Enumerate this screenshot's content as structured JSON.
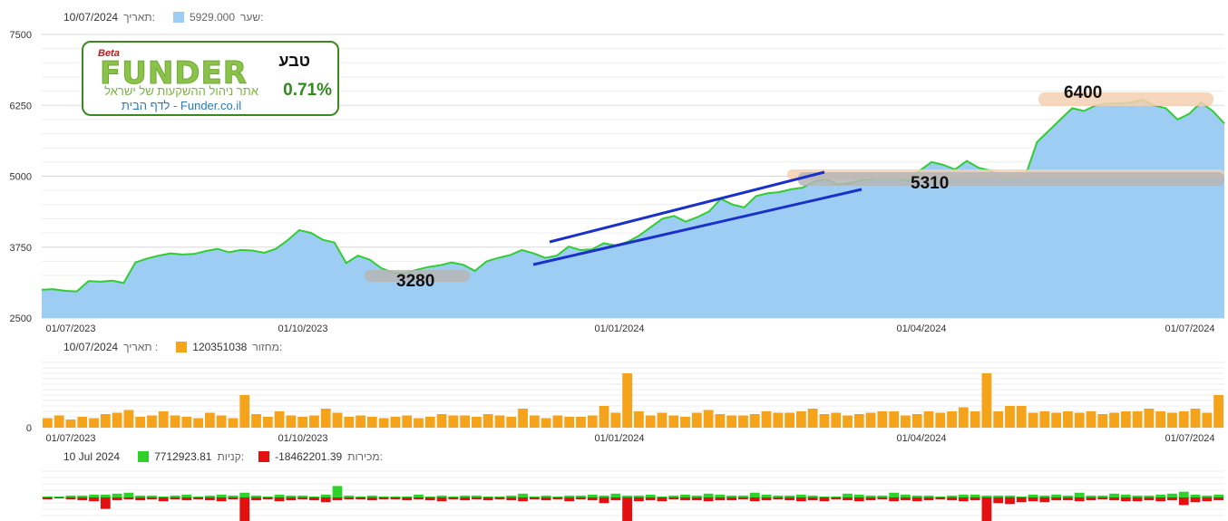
{
  "price_legend": {
    "date_label": "תאריך:",
    "date_value": "10/07/2024",
    "rate_label": "שער:",
    "rate_value": "5929.000",
    "color": "#9ecdf3"
  },
  "volume_legend": {
    "date_label": "תאריך :",
    "date_value": "10/07/2024",
    "turnover_label": "מחזור:",
    "turnover_value": "120351038",
    "color": "#f5a31a"
  },
  "flow_legend": {
    "date_value": "10 Jul 2024",
    "buys_label": "קניות:",
    "buys_value": "7712923.81",
    "buys_color": "#2fd12b",
    "sells_label": "מכירות:",
    "sells_value": "-18462201.39",
    "sells_color": "#e21010"
  },
  "logo": {
    "beta": "Beta",
    "wordmark": "FUNDER",
    "tagline": "אתר ניהול ההשקעות של ישראל",
    "link_text": "לדף הבית - Funder.co.il",
    "instrument": "טבע",
    "change": "0.71%"
  },
  "annotations": {
    "level_low": "3280",
    "level_mid": "5310",
    "level_high": "6400"
  },
  "chart_data": [
    {
      "type": "area",
      "y_ticks": [
        "7500",
        "6250",
        "5000",
        "3750",
        "2500"
      ],
      "ylim": [
        2500,
        7500
      ],
      "x_tick_labels": [
        "01/07/2023",
        "01/10/2023",
        "01/01/2024",
        "01/04/2024",
        "01/07/2024"
      ],
      "series": [
        {
          "name": "שער",
          "color": "#9ecdf3",
          "line_color": "#32cd32",
          "values": [
            3000,
            3010,
            2980,
            2970,
            3150,
            3140,
            3160,
            3120,
            3480,
            3550,
            3600,
            3640,
            3620,
            3630,
            3680,
            3720,
            3660,
            3700,
            3690,
            3650,
            3720,
            3870,
            4050,
            4000,
            3880,
            3830,
            3470,
            3600,
            3530,
            3380,
            3300,
            3290,
            3350,
            3400,
            3430,
            3480,
            3440,
            3330,
            3500,
            3560,
            3610,
            3700,
            3640,
            3560,
            3600,
            3760,
            3700,
            3710,
            3820,
            3780,
            3840,
            3950,
            4100,
            4250,
            4300,
            4200,
            4280,
            4380,
            4600,
            4500,
            4450,
            4650,
            4700,
            4720,
            4770,
            4800,
            4910,
            4950,
            4850,
            4880,
            4930,
            4950,
            4980,
            4960,
            4920,
            5100,
            5250,
            5200,
            5120,
            5270,
            5150,
            5100,
            5000,
            4950,
            5000,
            5600,
            5800,
            6000,
            6200,
            6150,
            6250,
            6280,
            6280,
            6300,
            6350,
            6250,
            6200,
            6000,
            6100,
            6300,
            6150,
            5929
          ]
        }
      ]
    },
    {
      "type": "bar",
      "y_ticks": [
        "0"
      ],
      "x_tick_labels": [
        "01/07/2023",
        "01/10/2023",
        "01/01/2024",
        "01/04/2024",
        "01/07/2024"
      ],
      "series": [
        {
          "name": "מחזור",
          "color": "#f5a31a",
          "values": [
            35,
            45,
            30,
            40,
            35,
            50,
            55,
            65,
            40,
            45,
            60,
            45,
            40,
            35,
            55,
            45,
            35,
            120,
            50,
            40,
            60,
            45,
            40,
            45,
            70,
            55,
            40,
            45,
            40,
            35,
            40,
            45,
            35,
            40,
            50,
            45,
            45,
            40,
            50,
            45,
            40,
            70,
            45,
            35,
            45,
            40,
            40,
            45,
            80,
            55,
            200,
            60,
            45,
            55,
            45,
            40,
            55,
            65,
            50,
            45,
            45,
            50,
            60,
            55,
            55,
            60,
            70,
            50,
            55,
            45,
            50,
            55,
            60,
            60,
            45,
            50,
            60,
            55,
            60,
            75,
            60,
            200,
            60,
            80,
            80,
            55,
            60,
            55,
            60,
            55,
            60,
            50,
            55,
            60,
            60,
            70,
            60,
            55,
            60,
            70,
            55,
            120
          ]
        }
      ]
    },
    {
      "type": "bar",
      "x_tick_labels": [
        "01/07/2023",
        "01/10/2023",
        "01/01/2024",
        "01/04/2024",
        "01/07/2024"
      ],
      "series": [
        {
          "name": "קניות",
          "color": "#2fd12b",
          "values": [
            1,
            1,
            2,
            2,
            3,
            3,
            4,
            5,
            2,
            2,
            1,
            2,
            3,
            1,
            2,
            3,
            2,
            5,
            2,
            1,
            3,
            2,
            2,
            1,
            3,
            12,
            2,
            1,
            2,
            1,
            1,
            1,
            3,
            1,
            2,
            1,
            2,
            2,
            1,
            1,
            2,
            4,
            1,
            2,
            1,
            2,
            2,
            3,
            2,
            4,
            2,
            2,
            3,
            1,
            2,
            3,
            2,
            4,
            3,
            2,
            2,
            5,
            3,
            2,
            2,
            3,
            2,
            1,
            1,
            4,
            3,
            2,
            2,
            5,
            3,
            2,
            2,
            1,
            2,
            3,
            3,
            2,
            2,
            2,
            1,
            3,
            2,
            3,
            2,
            5,
            2,
            2,
            4,
            3,
            2,
            2,
            3,
            4,
            6,
            3,
            2,
            3
          ]
        },
        {
          "name": "מכירות",
          "color": "#e21010",
          "values": [
            -2,
            -1,
            -2,
            -3,
            -4,
            -12,
            -3,
            -2,
            -3,
            -2,
            -4,
            -2,
            -3,
            -2,
            -3,
            -4,
            -2,
            -25,
            -3,
            -2,
            -4,
            -3,
            -2,
            -3,
            -5,
            -3,
            -2,
            -2,
            -3,
            -2,
            -2,
            -3,
            -2,
            -3,
            -4,
            -2,
            -3,
            -2,
            -3,
            -2,
            -3,
            -4,
            -2,
            -3,
            -2,
            -4,
            -2,
            -3,
            -6,
            -3,
            -25,
            -4,
            -3,
            -4,
            -2,
            -3,
            -3,
            -4,
            -3,
            -3,
            -2,
            -4,
            -3,
            -2,
            -3,
            -4,
            -3,
            -4,
            -2,
            -3,
            -4,
            -3,
            -2,
            -4,
            -3,
            -4,
            -3,
            -2,
            -3,
            -4,
            -3,
            -25,
            -6,
            -7,
            -5,
            -4,
            -5,
            -3,
            -3,
            -4,
            -3,
            -2,
            -3,
            -4,
            -4,
            -3,
            -4,
            -3,
            -8,
            -5,
            -4,
            -3
          ]
        }
      ]
    }
  ]
}
